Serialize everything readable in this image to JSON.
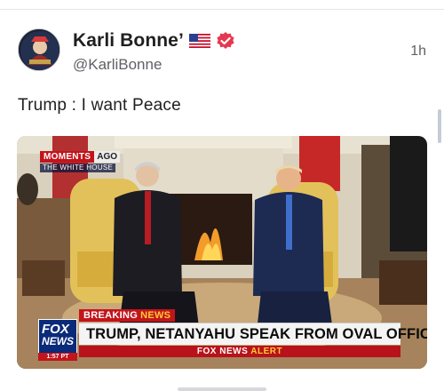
{
  "post": {
    "author": {
      "display_name": "Karli Bonne’",
      "handle": "@KarliBonne",
      "flag": "🇺🇸",
      "verified_icon": "verified-badge-icon"
    },
    "timestamp": "1h",
    "text": "Trump : I want Peace"
  },
  "media": {
    "overlay": {
      "moments_label": "MOMENTS",
      "ago_label": "AGO",
      "location_label": "THE WHITE HOUSE",
      "breaking_label": "BREAKING",
      "breaking_news_word": "NEWS",
      "headline": "TRUMP, NETANYAHU SPEAK FROM OVAL OFFICE",
      "alert_brand": "FOX NEWS",
      "alert_word": "ALERT",
      "logo_top": "FOX",
      "logo_bottom": "NEWS",
      "clock": "1:57 PT"
    }
  },
  "colors": {
    "fox_red": "#c3141b",
    "fox_blue": "#0a2a7a",
    "verified": "#e5384f"
  }
}
